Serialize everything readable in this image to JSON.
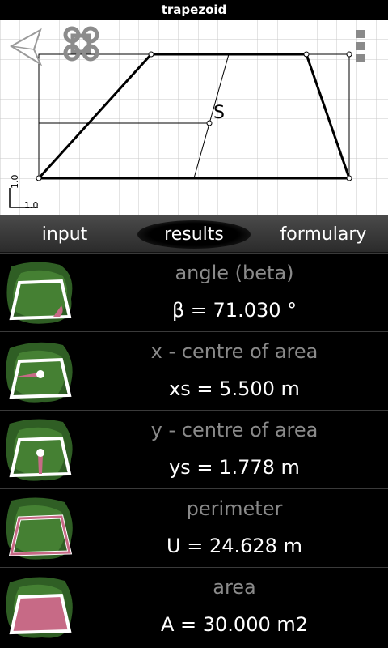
{
  "window": {
    "title": "trapezoid"
  },
  "drawing": {
    "label_s": "S",
    "scale_x": "1.0",
    "scale_y": "1.0"
  },
  "tabs": [
    {
      "label": "input"
    },
    {
      "label": "results"
    },
    {
      "label": "formulary"
    }
  ],
  "results": [
    {
      "title": "angle (beta)",
      "value": "β = 71.030 °",
      "icon": "angle-beta-icon"
    },
    {
      "title": "x - centre of area",
      "value": "xs = 5.500 m",
      "icon": "x-centre-icon"
    },
    {
      "title": "y - centre of area",
      "value": "ys = 1.778 m",
      "icon": "y-centre-icon"
    },
    {
      "title": "perimeter",
      "value": "U = 24.628 m",
      "icon": "perimeter-icon"
    },
    {
      "title": "area",
      "value": "A = 30.000 m2",
      "icon": "area-icon"
    }
  ],
  "colors": {
    "accent_pink": "#c76a86",
    "leaf_green": "#3f7a2f"
  }
}
